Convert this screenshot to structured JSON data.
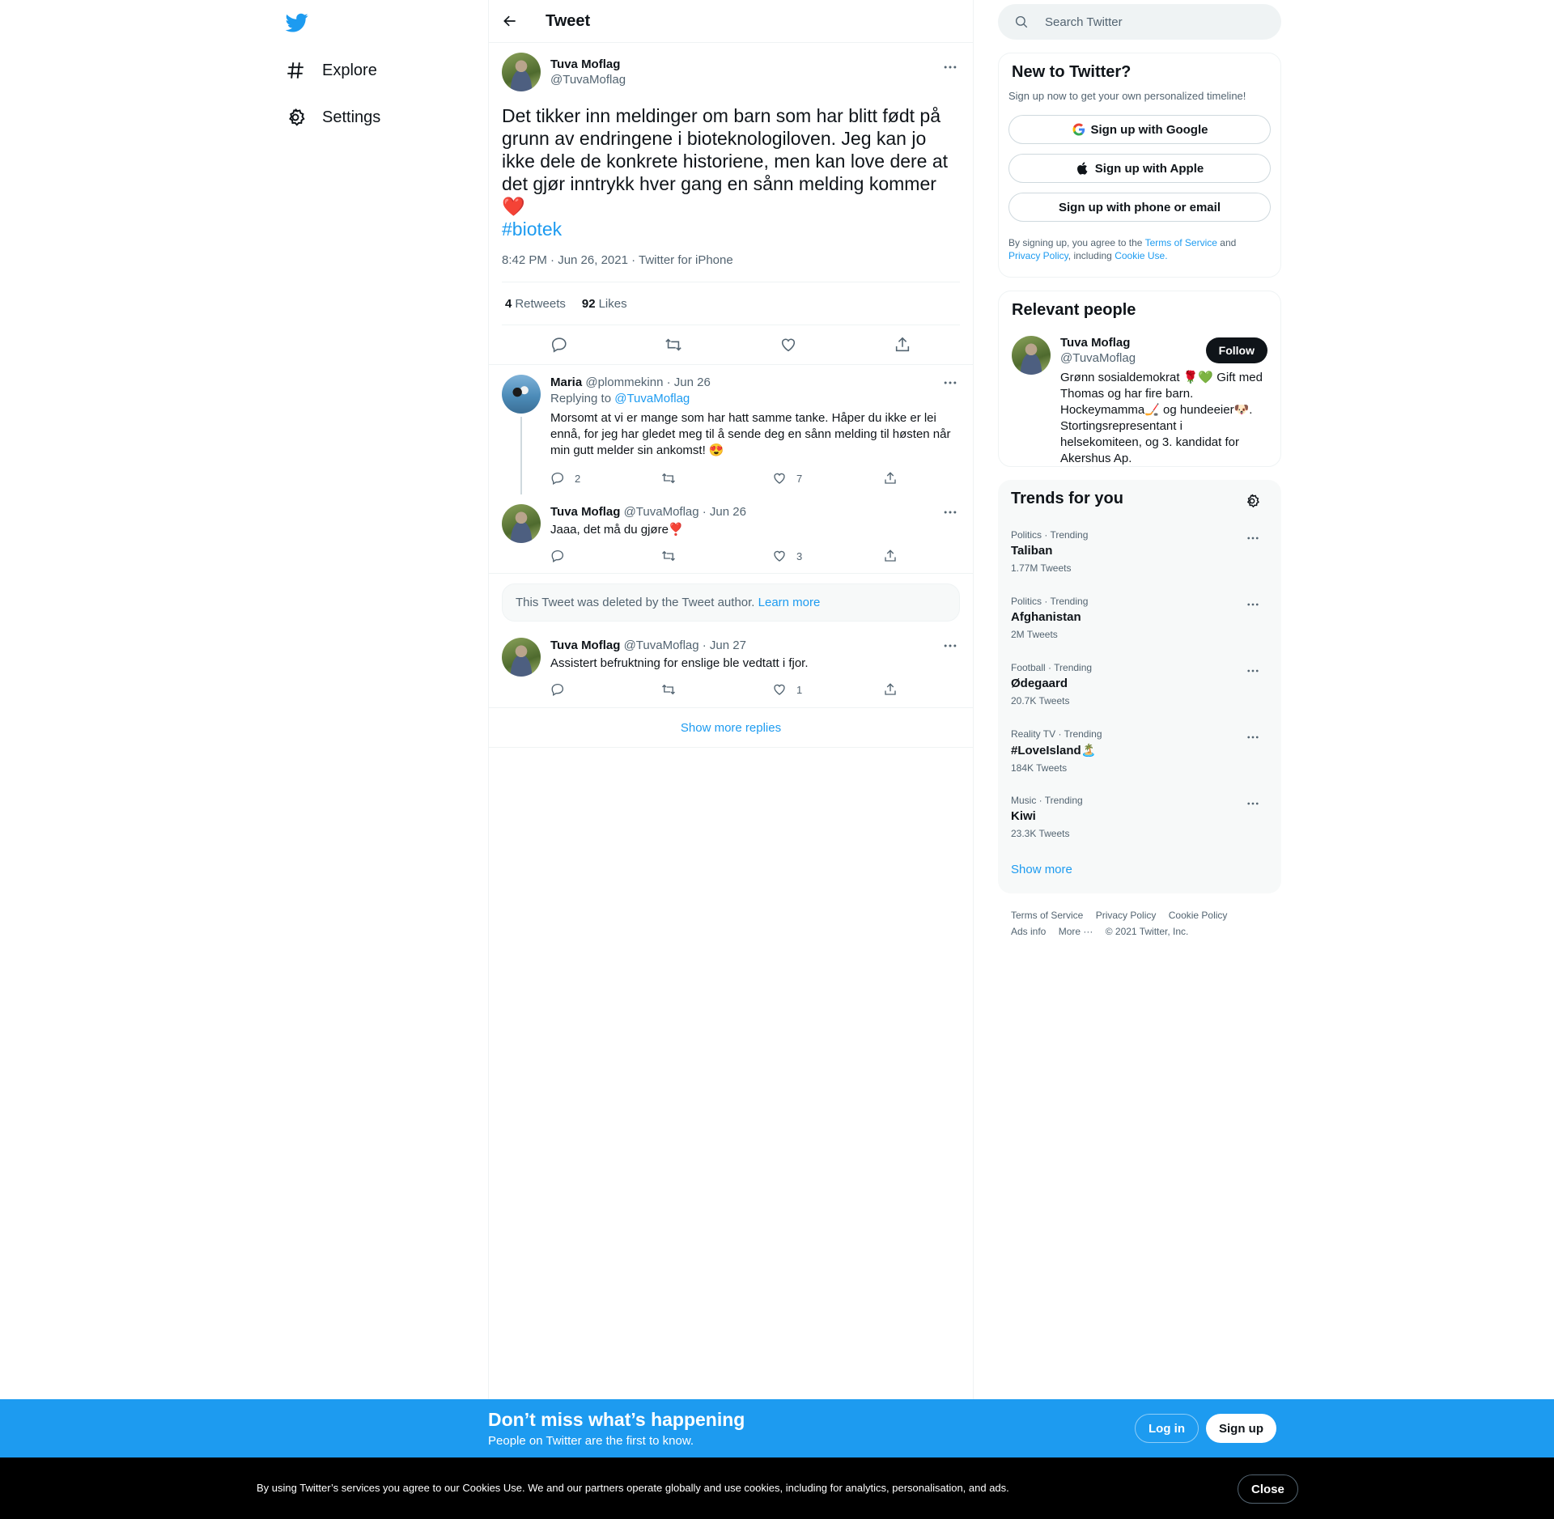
{
  "nav": {
    "explore": "Explore",
    "settings": "Settings"
  },
  "header": {
    "title": "Tweet"
  },
  "tweet": {
    "display_name": "Tuva Moflag",
    "username": "@TuvaMoflag",
    "text": "Det tikker inn meldinger om barn som har blitt født på grunn av endringene i bioteknologiloven. Jeg kan jo ikke dele de konkrete historiene, men kan love dere at det gjør inntrykk hver gang en sånn melding kommer ❤️",
    "hashtag": "#biotek",
    "meta": "8:42 PM · Jun 26, 2021 · Twitter for iPhone",
    "retweets_count": "4",
    "retweets_label": "Retweets",
    "likes_count": "92",
    "likes_label": "Likes"
  },
  "replies": [
    {
      "display_name": "Maria",
      "handle_date": "@plommekinn · Jun 26",
      "replying_prefix": "Replying to",
      "replying_to": "@TuvaMoflag",
      "text": "Morsomt at vi er mange som har hatt samme tanke. Håper du ikke er lei ennå, for jeg har gledet meg til å sende deg en sånn melding til høsten når min gutt melder sin ankomst! 😍",
      "replies": "2",
      "retweets": "",
      "likes": "7"
    },
    {
      "display_name": "Tuva Moflag",
      "handle_date": "@TuvaMoflag · Jun 26",
      "text": "Jaaa, det må du gjøre❣️",
      "replies": "",
      "retweets": "",
      "likes": "3"
    },
    {
      "display_name": "Tuva Moflag",
      "handle_date": "@TuvaMoflag · Jun 27",
      "text": "Assistert befruktning for enslige ble vedtatt i fjor.",
      "replies": "",
      "retweets": "",
      "likes": "1"
    }
  ],
  "deleted_notice": {
    "text": "This Tweet was deleted by the Tweet author.",
    "link": "Learn more"
  },
  "show_more_replies": "Show more replies",
  "search": {
    "placeholder": "Search Twitter"
  },
  "signup": {
    "title": "New to Twitter?",
    "subtitle": "Sign up now to get your own personalized timeline!",
    "google": "Sign up with Google",
    "apple": "Sign up with Apple",
    "phone": "Sign up with phone or email",
    "terms_1": "By signing up, you agree to the",
    "terms_link": "Terms of Service",
    "terms_2": "and",
    "privacy_link": "Privacy Policy",
    "terms_3": ", including",
    "cookie_link": "Cookie Use."
  },
  "relevant_people": {
    "title": "Relevant people",
    "display_name": "Tuva Moflag",
    "username": "@TuvaMoflag",
    "follow": "Follow",
    "bio": "Grønn sosialdemokrat 🌹💚 Gift med Thomas og har fire barn. Hockeymamma🏒 og hundeeier🐶. Stortingsrepresentant i helsekomiteen, og 3. kandidat for Akershus Ap."
  },
  "trends": {
    "title": "Trends for you",
    "items": [
      {
        "context": "Politics · Trending",
        "name": "Taliban",
        "count": "1.77M Tweets"
      },
      {
        "context": "Politics · Trending",
        "name": "Afghanistan",
        "count": "2M Tweets"
      },
      {
        "context": "Football · Trending",
        "name": "Ødegaard",
        "count": "20.7K Tweets"
      },
      {
        "context": "Reality TV · Trending",
        "name": "#LoveIsland🏝️",
        "count": "184K Tweets"
      },
      {
        "context": "Music · Trending",
        "name": "Kiwi",
        "count": "23.3K Tweets"
      }
    ],
    "show_more": "Show more"
  },
  "footer": {
    "terms": "Terms of Service",
    "privacy": "Privacy Policy",
    "cookie": "Cookie Policy",
    "ads": "Ads info",
    "more": "More ···",
    "copyright": "© 2021 Twitter, Inc."
  },
  "bottom_bar": {
    "title": "Don’t miss what’s happening",
    "subtitle": "People on Twitter are the first to know.",
    "login": "Log in",
    "signup": "Sign up"
  },
  "cookie_banner": {
    "text": "By using Twitter’s services you agree to our Cookies Use. We and our partners operate globally and use cookies, including for analytics, personalisation, and ads.",
    "close": "Close"
  },
  "colors": {
    "accent": "#1d9bf0",
    "text": "#0f1419",
    "muted": "#536471"
  }
}
